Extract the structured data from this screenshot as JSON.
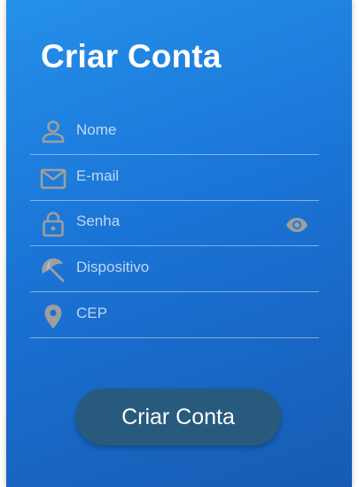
{
  "form": {
    "title": "Criar Conta",
    "fields": [
      {
        "placeholder": "Nome",
        "icon": "person-icon"
      },
      {
        "placeholder": "E-mail",
        "icon": "mail-icon"
      },
      {
        "placeholder": "Senha",
        "icon": "lock-icon",
        "trailing_icon": "eye-icon"
      },
      {
        "placeholder": "Dispositivo",
        "icon": "beach-umbrella-icon"
      },
      {
        "placeholder": "CEP",
        "icon": "location-pin-icon"
      }
    ],
    "submit_label": "Criar Conta"
  },
  "colors": {
    "gradient_start": "#2590ea",
    "gradient_end": "#175bb3",
    "icon": "#9e9e9e",
    "button": "#285a7e",
    "text": "#ffffff"
  }
}
